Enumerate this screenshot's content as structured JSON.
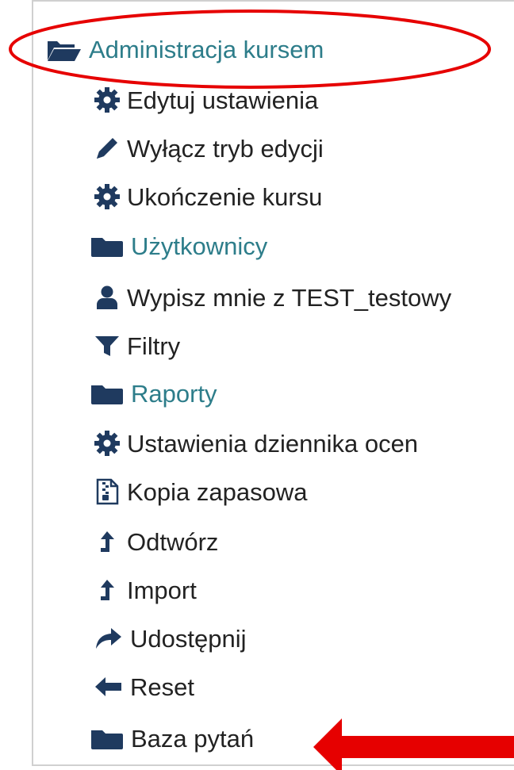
{
  "menu": {
    "header": {
      "label": "Administracja kursem",
      "icon": "folder-open-icon"
    },
    "items": [
      {
        "label": "Edytuj ustawienia",
        "icon": "gear-icon"
      },
      {
        "label": "Wyłącz tryb edycji",
        "icon": "pencil-icon"
      },
      {
        "label": "Ukończenie kursu",
        "icon": "gear-icon"
      },
      {
        "label": "Użytkownicy",
        "icon": "folder-icon"
      },
      {
        "label": "Wypisz mnie z TEST_testowy",
        "icon": "user-icon"
      },
      {
        "label": "Filtry",
        "icon": "filter-icon"
      },
      {
        "label": "Raporty",
        "icon": "folder-icon"
      },
      {
        "label": "Ustawienia dziennika ocen",
        "icon": "gear-icon"
      },
      {
        "label": "Kopia zapasowa",
        "icon": "archive-file-icon"
      },
      {
        "label": "Odtwórz",
        "icon": "upload-arrow-icon"
      },
      {
        "label": "Import",
        "icon": "upload-arrow-icon"
      },
      {
        "label": "Udostępnij",
        "icon": "share-arrow-icon"
      },
      {
        "label": "Reset",
        "icon": "arrow-left-icon"
      },
      {
        "label": "Baza pytań",
        "icon": "folder-icon"
      }
    ]
  },
  "colors": {
    "link": "#2d7d8a",
    "text": "#222222",
    "icon": "#1f3a5f",
    "annotation": "#e60000"
  }
}
